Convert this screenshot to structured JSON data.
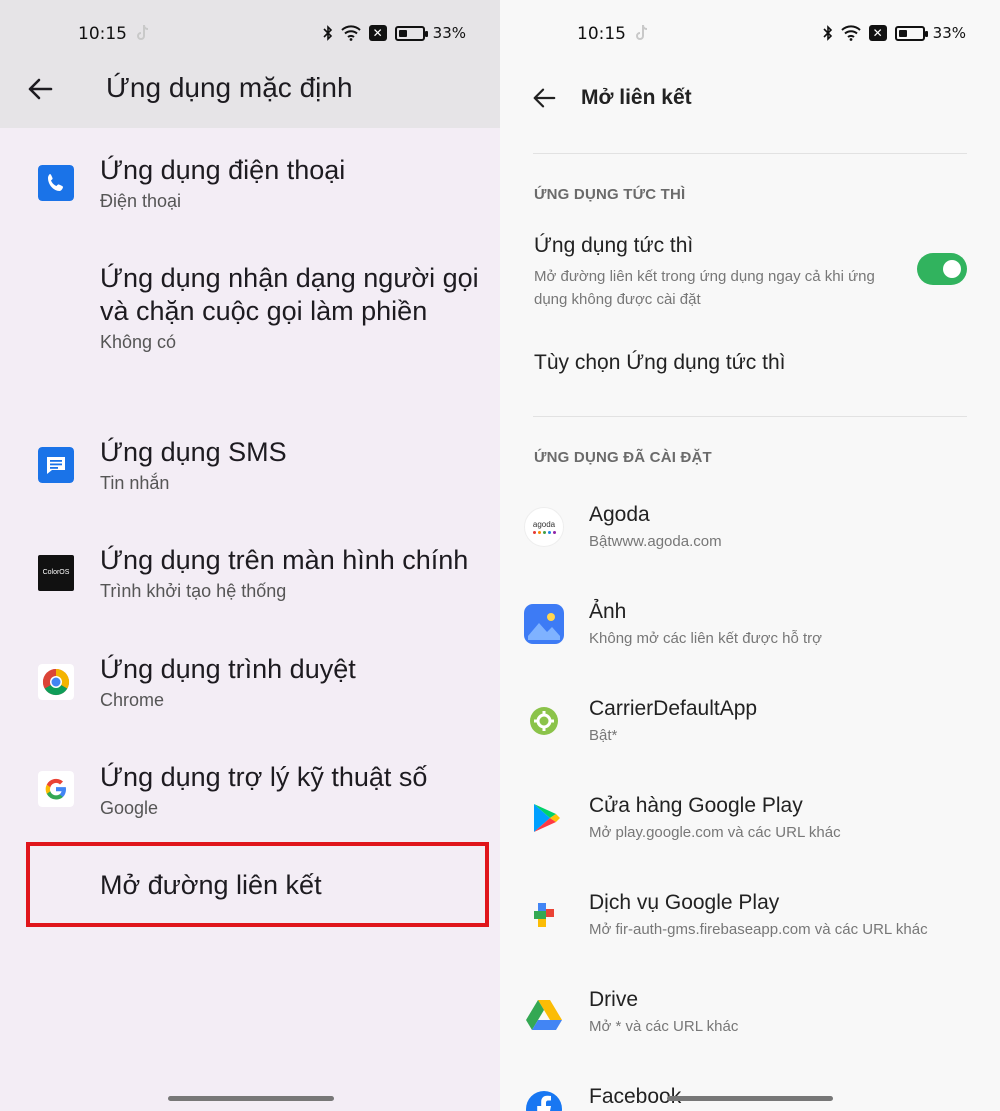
{
  "left": {
    "status": {
      "time": "10:15",
      "battery": "33%",
      "battery_level": 0.33
    },
    "title": "Ứng dụng mặc định",
    "items": [
      {
        "title": "Ứng dụng điện thoại",
        "subtitle": "Điện thoại",
        "icon": "phone-icon"
      },
      {
        "title": "Ứng dụng nhận dạng người gọi và chặn cuộc gọi làm phiền",
        "subtitle": "Không có",
        "icon": ""
      },
      {
        "title": "Ứng dụng SMS",
        "subtitle": "Tin nhắn",
        "icon": "messages-icon"
      },
      {
        "title": "Ứng dụng trên màn hình chính",
        "subtitle": "Trình khởi tạo hệ thống",
        "icon": "coloros-icon"
      },
      {
        "title": "Ứng dụng trình duyệt",
        "subtitle": "Chrome",
        "icon": "chrome-icon"
      },
      {
        "title": "Ứng dụng trợ lý kỹ thuật số",
        "subtitle": "Google",
        "icon": "google-icon"
      },
      {
        "title": "Mở đường liên kết",
        "subtitle": "",
        "icon": ""
      }
    ],
    "coloros_label": "ColorOS"
  },
  "right": {
    "status": {
      "time": "10:15",
      "battery": "33%",
      "battery_level": 0.33
    },
    "title": "Mở liên kết",
    "section_instant": "ỨNG DỤNG TỨC THÌ",
    "instant_apps": {
      "title": "Ứng dụng tức thì",
      "description": "Mở đường liên kết trong ứng dụng ngay cả khi ứng dụng không được cài đặt",
      "enabled": true
    },
    "instant_options": "Tùy chọn Ứng dụng tức thì",
    "section_installed": "ỨNG DỤNG ĐÃ CÀI ĐẶT",
    "apps": [
      {
        "name": "Agoda",
        "detail": "Bậtwww.agoda.com",
        "icon": "agoda-icon",
        "icon_text": "agoda"
      },
      {
        "name": "Ảnh",
        "detail": "Không mở các liên kết được hỗ trợ",
        "icon": "photos-icon"
      },
      {
        "name": "CarrierDefaultApp",
        "detail": "Bật*",
        "icon": "carrier-gear-icon"
      },
      {
        "name": "Cửa hàng Google Play",
        "detail": "Mở play.google.com và các URL khác",
        "icon": "play-store-icon"
      },
      {
        "name": "Dịch vụ Google Play",
        "detail": "Mở fir-auth-gms.firebaseapp.com và các URL khác",
        "icon": "play-services-icon"
      },
      {
        "name": "Drive",
        "detail": "Mở * và các URL khác",
        "icon": "drive-icon"
      },
      {
        "name": "Facebook",
        "detail": "",
        "icon": "facebook-icon"
      }
    ]
  },
  "colors": {
    "accent_red": "#e0151b",
    "toggle_green": "#31b35e",
    "phone_blue": "#1a73e8"
  }
}
